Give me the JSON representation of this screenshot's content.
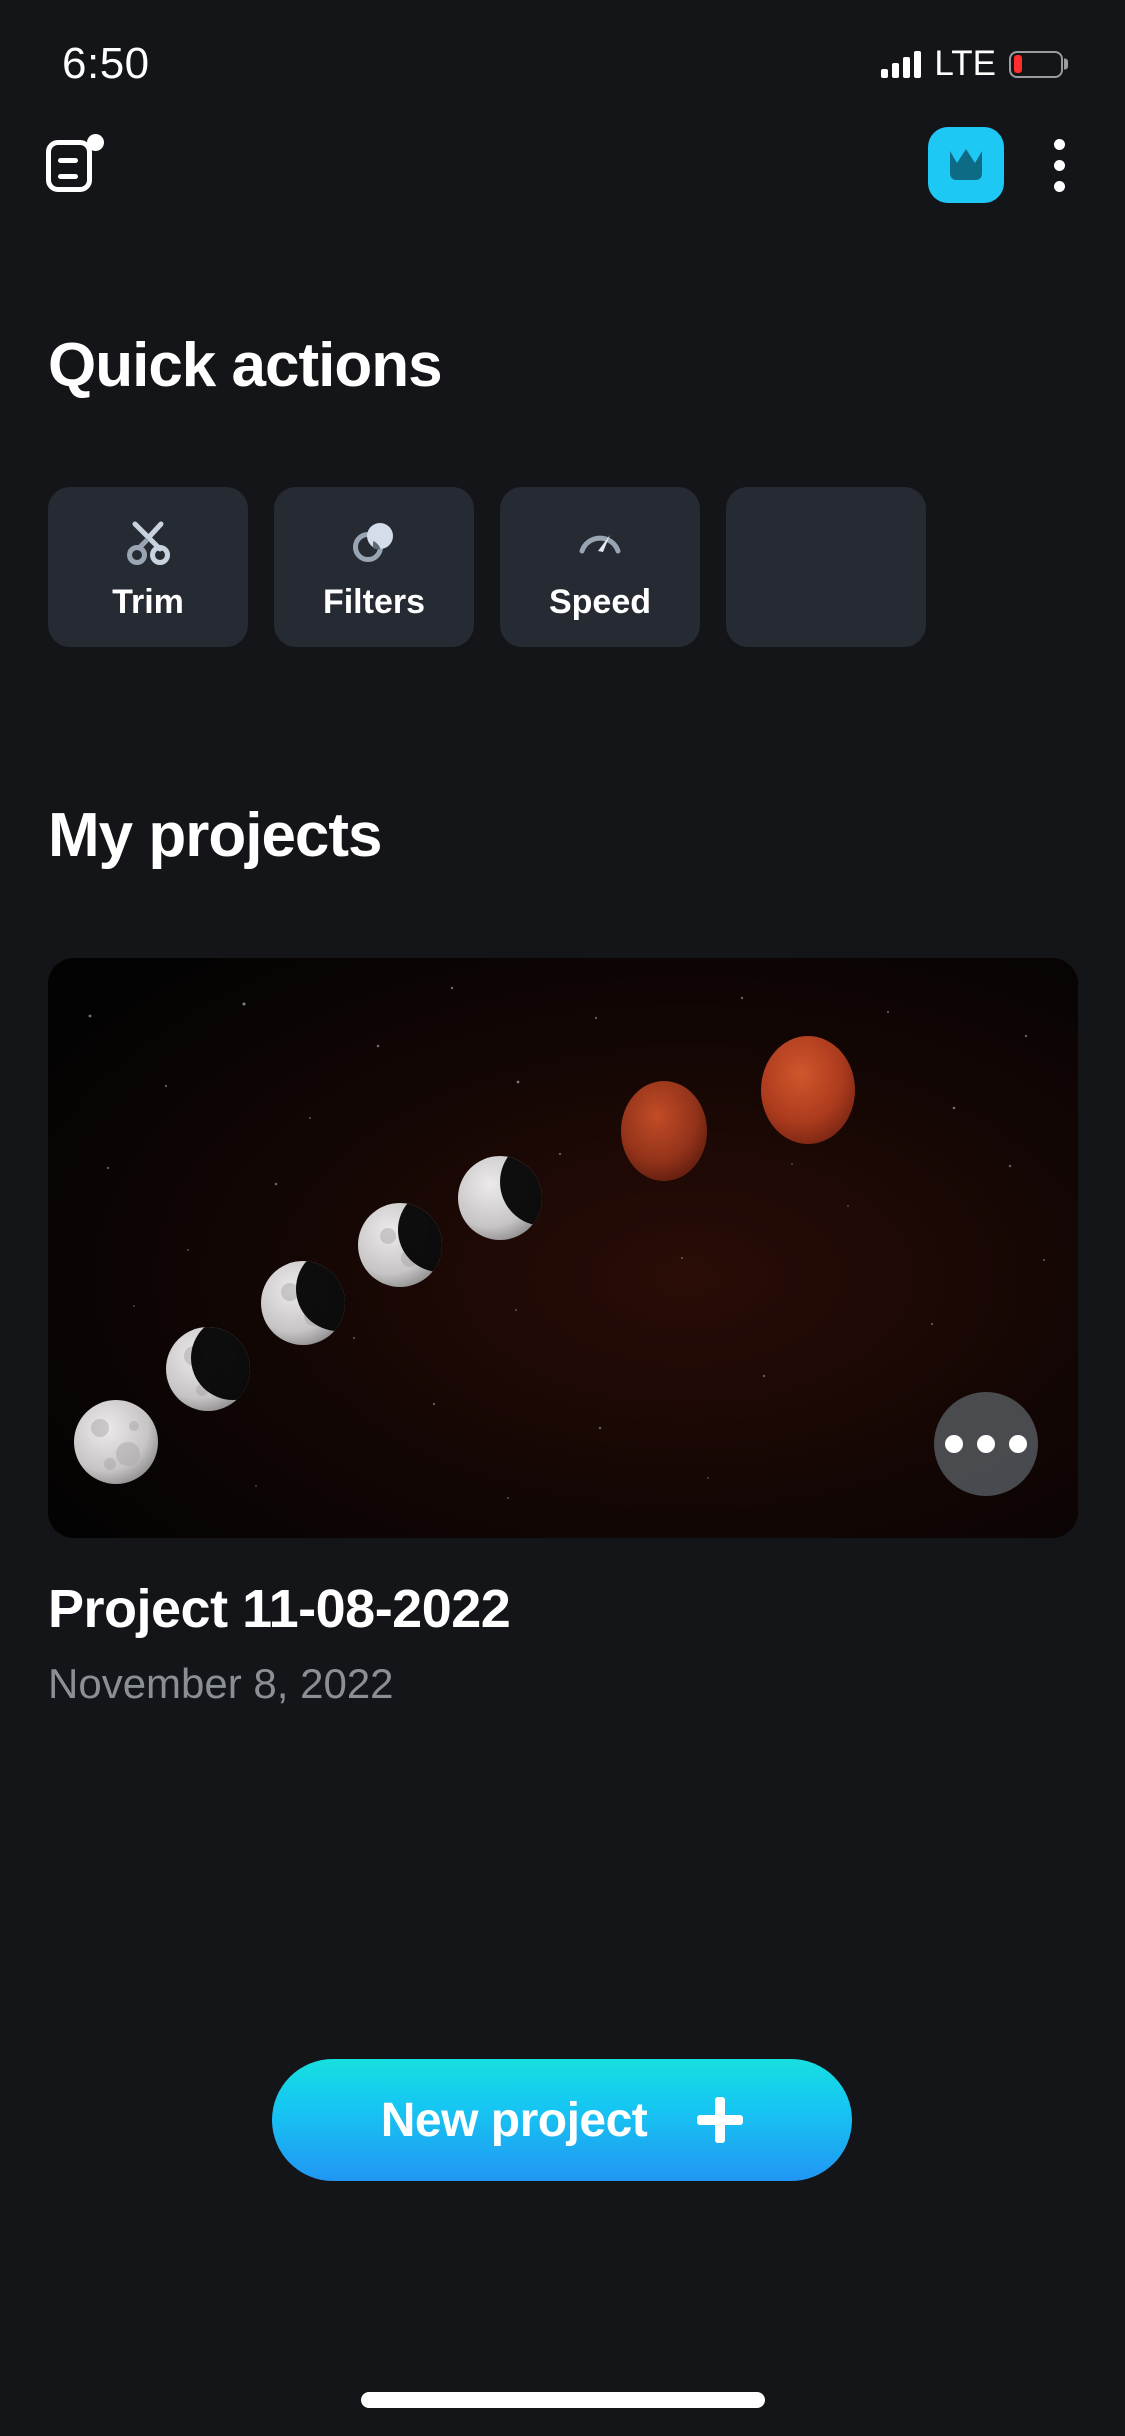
{
  "status_bar": {
    "time": "6:50",
    "network_label": "LTE",
    "signal_icon": "signal-bars-icon",
    "battery_icon": "battery-low-icon",
    "battery_level_percent": 18,
    "battery_color": "#ff2d2d"
  },
  "app_bar": {
    "feed_icon": "feed-notification-icon",
    "premium_badge_icon": "crown-icon",
    "premium_badge_color": "#1ec8f5",
    "overflow_icon": "kebab-menu-icon"
  },
  "quick_actions": {
    "heading": "Quick actions",
    "items": [
      {
        "label": "Trim",
        "icon": "scissors-icon"
      },
      {
        "label": "Filters",
        "icon": "overlapping-circles-icon"
      },
      {
        "label": "Speed",
        "icon": "speedometer-icon"
      },
      {
        "label": "",
        "icon": "partial-card-icon"
      }
    ]
  },
  "my_projects": {
    "heading": "My projects",
    "projects": [
      {
        "title": "Project 11-08-2022",
        "date": "November 8, 2022",
        "thumbnail_description": "lunar-eclipse-phase-sequence",
        "more_icon": "more-horizontal-icon"
      }
    ]
  },
  "new_project_button": {
    "label": "New project",
    "icon": "plus-icon",
    "gradient_start": "#17dfe0",
    "gradient_end": "#2196f3"
  },
  "system": {
    "home_indicator": "home-indicator"
  },
  "theme": {
    "background": "#141518",
    "card_background": "#262b33",
    "accent": "#1ec8f5",
    "text_primary": "#ffffff",
    "text_secondary": "#8a8f96"
  }
}
